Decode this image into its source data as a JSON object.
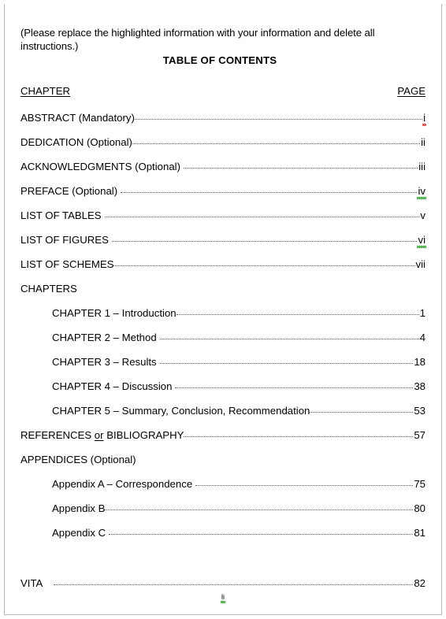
{
  "header": {
    "instruction": "(Please replace the highlighted information with your information and delete all instructions.)",
    "title": "TABLE OF CONTENTS",
    "col_chapter": "CHAPTER",
    "col_page": "PAGE"
  },
  "entries": [
    {
      "label": "ABSTRACT (Mandatory)",
      "page": "i",
      "indent": 0,
      "gap": "none",
      "leader": true,
      "squiggle": "red"
    },
    {
      "label": "DEDICATION (Optional)",
      "page": "ii",
      "indent": 0,
      "gap": "none",
      "leader": true,
      "squiggle": "none"
    },
    {
      "label": "ACKNOWLEDGMENTS (Optional)",
      "page": "iii",
      "indent": 0,
      "gap": "sm",
      "leader": true,
      "squiggle": "none"
    },
    {
      "label": "PREFACE (Optional)",
      "page": "iv",
      "indent": 0,
      "gap": "sm",
      "leader": true,
      "squiggle": "green"
    },
    {
      "label": "LIST OF TABLES",
      "page": "v",
      "indent": 0,
      "gap": "sm",
      "leader": true,
      "squiggle": "none"
    },
    {
      "label": "LIST OF FIGURES",
      "page": "vi",
      "indent": 0,
      "gap": "sm",
      "leader": true,
      "squiggle": "green"
    },
    {
      "label": "LIST OF SCHEMES",
      "page": "vii",
      "indent": 0,
      "gap": "none",
      "leader": true,
      "squiggle": "none"
    },
    {
      "label": "CHAPTERS",
      "page": "",
      "indent": 0,
      "gap": "none",
      "leader": false,
      "squiggle": "none"
    },
    {
      "label": "CHAPTER 1 – Introduction",
      "page": "1",
      "indent": 1,
      "gap": "none",
      "leader": true,
      "squiggle": "none"
    },
    {
      "label": "CHAPTER 2 – Method",
      "page": "4",
      "indent": 1,
      "gap": "sm",
      "leader": true,
      "squiggle": "none"
    },
    {
      "label": "CHAPTER 3 – Results",
      "page": "18",
      "indent": 1,
      "gap": "sm",
      "leader": true,
      "squiggle": "none"
    },
    {
      "label": "CHAPTER 4 – Discussion",
      "page": "38",
      "indent": 1,
      "gap": "sm",
      "leader": true,
      "squiggle": "none"
    },
    {
      "label": "CHAPTER 5 – Summary, Conclusion, Recommendation",
      "page": "53",
      "indent": 1,
      "gap": "none",
      "leader": true,
      "squiggle": "none"
    },
    {
      "label": "REFERENCES or BIBLIOGRAPHY",
      "page": "57",
      "indent": 0,
      "gap": "none",
      "leader": true,
      "squiggle": "none",
      "underline_word": "or"
    },
    {
      "label": "APPENDICES (Optional)",
      "page": "",
      "indent": 0,
      "gap": "none",
      "leader": false,
      "squiggle": "none"
    },
    {
      "label": "Appendix A – Correspondence",
      "page": "75",
      "indent": 1,
      "gap": "sm",
      "leader": true,
      "squiggle": "none"
    },
    {
      "label": "Appendix B",
      "page": "80",
      "indent": 1,
      "gap": "none",
      "leader": true,
      "squiggle": "none"
    },
    {
      "label": "Appendix C",
      "page": "81",
      "indent": 1,
      "gap": "sm",
      "leader": true,
      "squiggle": "none"
    },
    {
      "label": "VITA",
      "page": "82",
      "indent": 0,
      "gap": "lg",
      "leader": true,
      "squiggle": "none",
      "space_before": true
    }
  ],
  "footer": {
    "page_label": "li",
    "squiggle": "green"
  },
  "colors": {
    "text": "#000000",
    "leader_dots": "#5b5b5b",
    "page_border": "#b9b9b9",
    "spellcheck_red": "#e02020",
    "spellcheck_green": "#1f9b1f"
  }
}
